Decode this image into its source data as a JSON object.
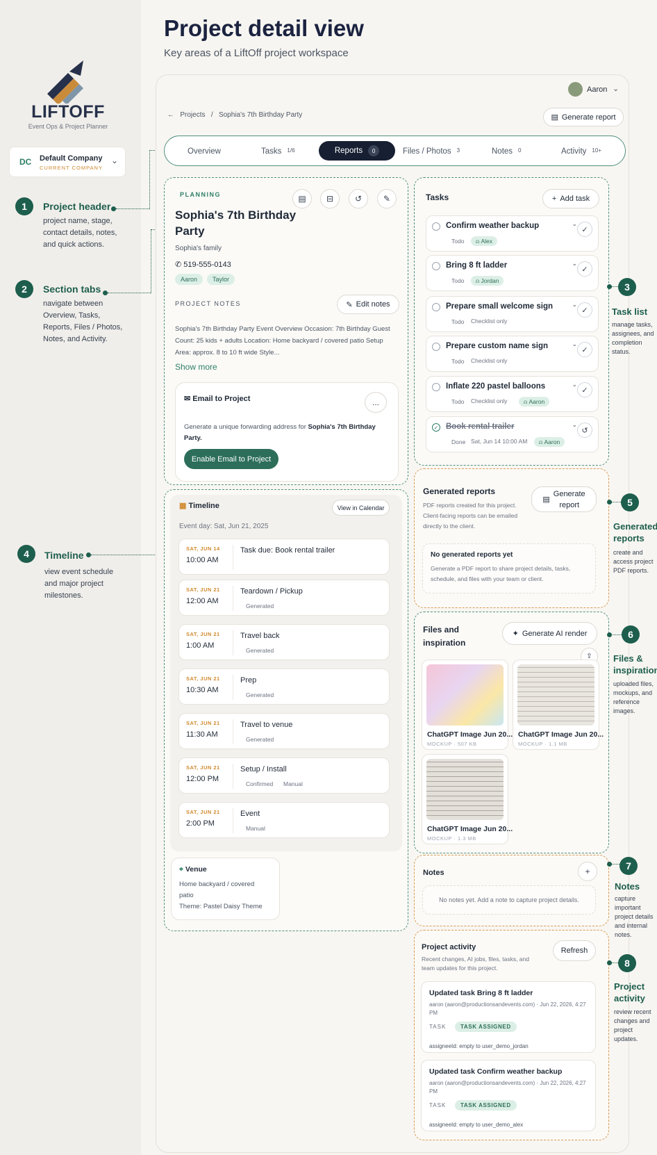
{
  "page": {
    "title": "Project detail view",
    "subtitle": "Key areas of a LiftOff project workspace"
  },
  "brand": {
    "name": "LIFTOFF",
    "tagline": "Event Ops & Project Planner",
    "accent": "#1d5e4d",
    "orange": "#d89a52"
  },
  "company": {
    "initials": "DC",
    "name": "Default Company",
    "label": "CURRENT COMPANY"
  },
  "user": {
    "name": "Aaron"
  },
  "breadcrumb": {
    "root": "Projects",
    "sep": "/",
    "current": "Sophia's 7th Birthday Party"
  },
  "header_action": "Generate report",
  "annotations": [
    {
      "n": "1",
      "title": "Project header",
      "desc": [
        "project name, stage,",
        "contact details, notes,",
        "and quick actions."
      ]
    },
    {
      "n": "2",
      "title": "Section tabs",
      "desc": [
        "navigate between",
        "Overview, Tasks,",
        "Reports, Files / Photos,",
        "Notes, and Activity."
      ]
    },
    {
      "n": "3",
      "title": "Task list",
      "desc": [
        "manage tasks,",
        "assignees, and",
        "completion",
        "status."
      ]
    },
    {
      "n": "4",
      "title": "Timeline",
      "desc": [
        "view event schedule",
        "and major project",
        "milestones."
      ]
    },
    {
      "n": "5",
      "title": "Generated reports",
      "desc": [
        "create and",
        "access project",
        "PDF reports."
      ]
    },
    {
      "n": "6",
      "title": "Files & inspiration",
      "desc": [
        "uploaded files,",
        "mockups, and",
        "reference",
        "images."
      ]
    },
    {
      "n": "7",
      "title": "Notes",
      "desc": [
        "capture",
        "important",
        "project details",
        "and internal",
        "notes."
      ]
    },
    {
      "n": "8",
      "title": "Project activity",
      "desc": [
        "review recent",
        "changes and",
        "project",
        "updates."
      ]
    }
  ],
  "tabs": [
    {
      "label": "Overview",
      "count": ""
    },
    {
      "label": "Tasks",
      "count": "1/6"
    },
    {
      "label": "Reports",
      "count": "0"
    },
    {
      "label": "Files / Photos",
      "count": "3"
    },
    {
      "label": "Notes",
      "count": "0"
    },
    {
      "label": "Activity",
      "count": "10+"
    }
  ],
  "project": {
    "stage": "PLANNING",
    "name_line1": "Sophia's 7th Birthday",
    "name_line2": "Party",
    "client": "Sophia's family",
    "phone": "519-555-0143",
    "people": [
      "Aaron",
      "Taylor"
    ],
    "notes_label": "PROJECT NOTES",
    "edit_notes": "Edit notes",
    "notes_text": "Sophia's 7th Birthday Party Event Overview Occasion: 7th Birthday Guest Count: 25 kids + adults Location: Home backyard / covered patio Setup Area: approx. 8 to 10 ft wide Style...",
    "show_more": "Show more",
    "email": {
      "title": "Email to Project",
      "menu": "...",
      "desc_prefix": "Generate a unique forwarding address for ",
      "desc_bold": "Sophia's 7th Birthday Party.",
      "button": "Enable Email to Project"
    }
  },
  "tasks": {
    "title": "Tasks",
    "add": "Add task",
    "items": [
      {
        "title": "Confirm weather backup",
        "status": "Todo",
        "meta": "",
        "assignee": "Alex",
        "done": false
      },
      {
        "title": "Bring 8 ft ladder",
        "status": "Todo",
        "meta": "",
        "assignee": "Jordan",
        "done": false
      },
      {
        "title": "Prepare small welcome sign",
        "status": "Todo",
        "meta": "Checklist only",
        "assignee": "",
        "done": false
      },
      {
        "title": "Prepare custom name sign",
        "status": "Todo",
        "meta": "Checklist only",
        "assignee": "",
        "done": false
      },
      {
        "title": "Inflate 220 pastel balloons",
        "status": "Todo",
        "meta": "Checklist only",
        "assignee": "Aaron",
        "done": false
      },
      {
        "title": "Book rental trailer",
        "status": "Done",
        "meta": "Sat, Jun 14 10:00 AM",
        "assignee": "Aaron",
        "done": true
      }
    ]
  },
  "timeline": {
    "title": "Timeline",
    "calendar": "View in Calendar",
    "event_day": "Event day: Sat, Jun 21, 2025",
    "items": [
      {
        "date": "SAT, JUN 14",
        "time": "10:00 AM",
        "title": "Task due: Book rental trailer",
        "tag": "",
        "tag2": ""
      },
      {
        "date": "SAT, JUN 21",
        "time": "12:00 AM",
        "title": "Teardown / Pickup",
        "tag": "Generated",
        "tag2": ""
      },
      {
        "date": "SAT, JUN 21",
        "time": "1:00 AM",
        "title": "Travel back",
        "tag": "Generated",
        "tag2": ""
      },
      {
        "date": "SAT, JUN 21",
        "time": "10:30 AM",
        "title": "Prep",
        "tag": "Generated",
        "tag2": ""
      },
      {
        "date": "SAT, JUN 21",
        "time": "11:30 AM",
        "title": "Travel to venue",
        "tag": "Generated",
        "tag2": ""
      },
      {
        "date": "SAT, JUN 21",
        "time": "12:00 PM",
        "title": "Setup / Install",
        "tag": "Confirmed",
        "tag2": "Manual"
      },
      {
        "date": "SAT, JUN 21",
        "time": "2:00 PM",
        "title": "Event",
        "tag": "Manual",
        "tag2": ""
      }
    ],
    "venue": {
      "title": "Venue",
      "line1": "Home backyard / covered",
      "line2": "patio",
      "theme": "Theme: Pastel Daisy Theme"
    }
  },
  "reports": {
    "title": "Generated reports",
    "desc": [
      "PDF reports created for this project.",
      "Client-facing reports can be emailed",
      "directly to the client."
    ],
    "button_line1": "Generate",
    "button_line2": "report",
    "empty_title": "No generated reports yet",
    "empty_desc": [
      "Generate a PDF report to share project details, tasks,",
      "schedule, and files with your team or client."
    ]
  },
  "files": {
    "title_line1": "Files and",
    "title_line2": "inspiration",
    "ai_button": "Generate AI render",
    "items": [
      {
        "name": "ChatGPT Image Jun 20...",
        "meta": "MOCKUP · 507 KB"
      },
      {
        "name": "ChatGPT Image Jun 20...",
        "meta": "MOCKUP · 1.1 MB"
      },
      {
        "name": "ChatGPT Image Jun 20...",
        "meta": "MOCKUP · 1.3 MB"
      }
    ]
  },
  "notes": {
    "title": "Notes",
    "empty": "No notes yet. Add a note to capture project details."
  },
  "activity": {
    "title": "Project activity",
    "desc": [
      "Recent changes, AI jobs, files, tasks, and",
      "team updates for this project."
    ],
    "refresh": "Refresh",
    "items": [
      {
        "title": "Updated task Bring 8 ft ladder",
        "by_line1": "aaron (aaron@productionsandevents.com) · Jun 22, 2026, 4:27",
        "by_line2": "PM",
        "kind": "TASK",
        "badge": "TASK ASSIGNED",
        "detail": "assigneeId: empty to user_demo_jordan"
      },
      {
        "title": "Updated task Confirm weather backup",
        "by_line1": "aaron (aaron@productionsandevents.com) · Jun 22, 2026, 4:27",
        "by_line2": "PM",
        "kind": "TASK",
        "badge": "TASK ASSIGNED",
        "detail": "assigneeId: empty to user_demo_alex"
      }
    ]
  }
}
